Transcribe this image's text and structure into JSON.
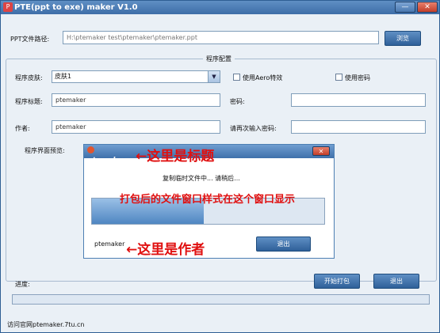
{
  "window": {
    "title": "PTE(ppt to exe) maker V1.0",
    "icon": "app-icon",
    "min_label": "—",
    "close_label": "✕"
  },
  "file": {
    "label": "PPT文件路径:",
    "value": "H:\\ptemaker test\\ptemaker\\ptemaker.ppt",
    "browse_label": "浏览"
  },
  "config": {
    "group_title": "程序配置",
    "skin_label": "程序皮肤:",
    "skin_value": "皮肤1",
    "aero_label": "使用Aero特效",
    "use_password_label": "使用密码",
    "title_label": "程序标题:",
    "title_value": "ptemaker",
    "password_label": "密码:",
    "password_value": "",
    "author_label": "作者:",
    "author_value": "ptemaker",
    "confirm_password_label": "请再次输入密码:",
    "confirm_password_value": "",
    "preview_label": "程序界面预览:"
  },
  "preview": {
    "logo_text": "ptemaker",
    "close_label": "✕",
    "status_text": "复制临时文件中... 请稍后...",
    "progress": 0.48,
    "author_text": "ptemaker",
    "exit_label": "退出"
  },
  "annotations": {
    "title_note": "←这里是标题",
    "window_note": "打包后的文件窗口样式在这个窗口显示",
    "author_note": "←这里是作者"
  },
  "progress": {
    "label": "进度:",
    "value": 0
  },
  "actions": {
    "start_label": "开始打包",
    "exit_label": "退出"
  },
  "footer": {
    "text": "访问官网ptemaker.7tu.cn"
  },
  "colors": {
    "title_bar": "#3e6ea8",
    "button": "#2f6099",
    "annotation": "#e01010"
  }
}
